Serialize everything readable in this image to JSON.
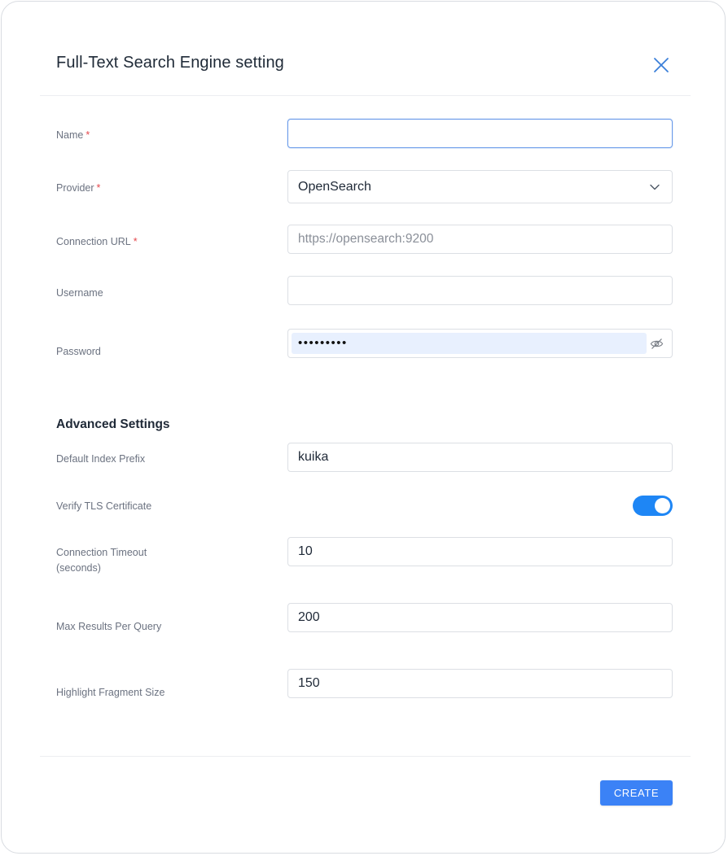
{
  "dialog": {
    "title": "Full-Text Search Engine setting",
    "close_icon": "close-icon"
  },
  "form": {
    "required_marker": "*",
    "name": {
      "label": "Name",
      "value": "",
      "placeholder": ""
    },
    "provider": {
      "label": "Provider",
      "selected": "OpenSearch",
      "icon": "chevron-down-icon"
    },
    "connection_url": {
      "label": "Connection URL",
      "value": "",
      "placeholder": "https://opensearch:9200"
    },
    "username": {
      "label": "Username",
      "value": ""
    },
    "password": {
      "label": "Password",
      "masked_value": "•••••••••",
      "icon": "eye-off-icon"
    }
  },
  "advanced": {
    "heading": "Advanced Settings",
    "default_index_prefix": {
      "label": "Default Index Prefix",
      "value": "kuika"
    },
    "verify_tls": {
      "label": "Verify TLS Certificate",
      "enabled": true
    },
    "connection_timeout": {
      "label_line1": "Connection Timeout",
      "label_line2": "(seconds)",
      "value": "10"
    },
    "max_results": {
      "label": "Max Results Per Query",
      "value": "200"
    },
    "highlight_fragment_size": {
      "label": "Highlight Fragment Size",
      "value": "150"
    }
  },
  "footer": {
    "create_label": "CREATE"
  },
  "colors": {
    "accent": "#3b82f6",
    "toggle_on": "#1e86f5",
    "required": "#e5484d"
  }
}
